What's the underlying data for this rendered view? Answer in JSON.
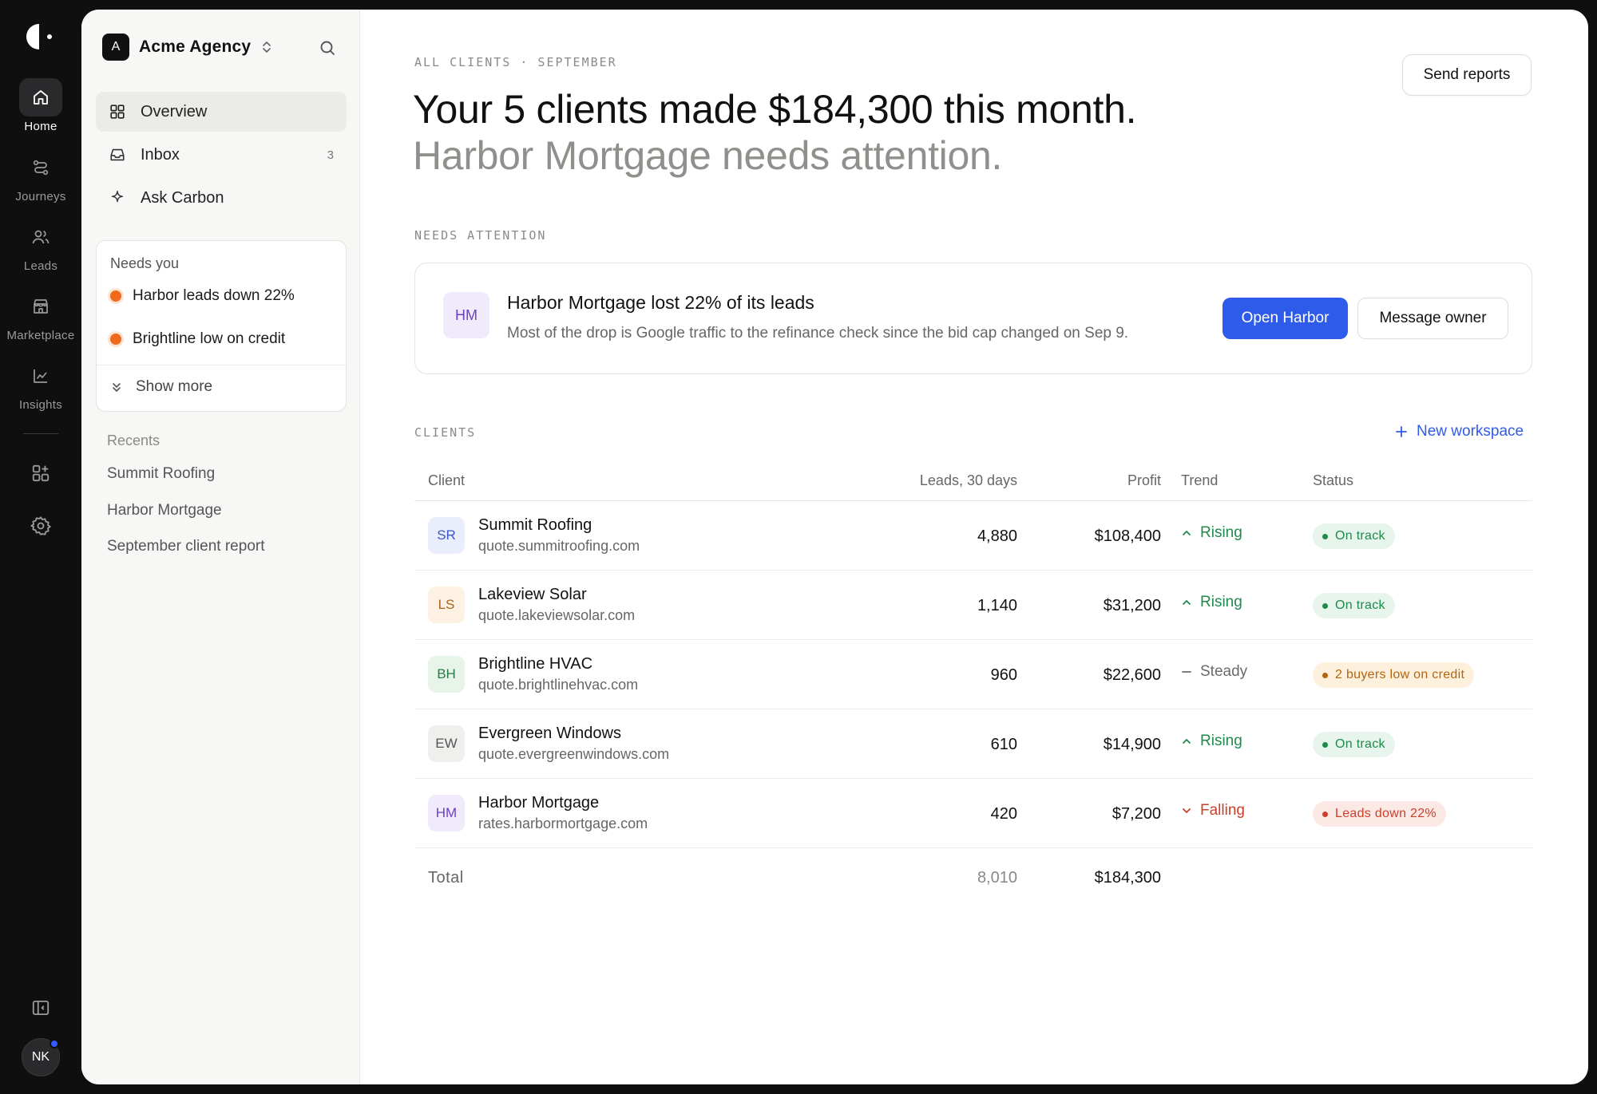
{
  "rail": {
    "items": [
      {
        "label": "Home",
        "icon": "home-icon"
      },
      {
        "label": "Journeys",
        "icon": "route-icon"
      },
      {
        "label": "Leads",
        "icon": "users-icon"
      },
      {
        "label": "Marketplace",
        "icon": "store-icon"
      },
      {
        "label": "Insights",
        "icon": "chart-icon"
      }
    ],
    "avatar": "NK"
  },
  "sidebar": {
    "workspace_initial": "A",
    "workspace_name": "Acme Agency",
    "nav": [
      {
        "label": "Overview"
      },
      {
        "label": "Inbox",
        "count": "3"
      },
      {
        "label": "Ask Carbon"
      }
    ],
    "needs": {
      "title": "Needs you",
      "items": [
        "Harbor leads down 22%",
        "Brightline low on credit"
      ],
      "more": "Show more"
    },
    "recents_title": "Recents",
    "recents": [
      "Summit Roofing",
      "Harbor Mortgage",
      "September client report"
    ]
  },
  "main": {
    "eyebrow": "ALL CLIENTS · SEPTEMBER",
    "send_reports": "Send reports",
    "headline": "Your 5 clients made $184,300 this month.",
    "subline": "Harbor Mortgage needs attention.",
    "attention_label": "NEEDS ATTENTION",
    "alert": {
      "initials": "HM",
      "title": "Harbor Mortgage lost 22% of its leads",
      "desc": "Most of the drop is Google traffic to the refinance check since the bid cap changed on Sep 9.",
      "primary": "Open Harbor",
      "secondary": "Message owner"
    },
    "clients_label": "CLIENTS",
    "new_workspace": "New workspace",
    "table": {
      "headers": {
        "client": "Client",
        "leads": "Leads, 30 days",
        "profit": "Profit",
        "trend": "Trend",
        "status": "Status"
      },
      "rows": [
        {
          "initials": "SR",
          "name": "Summit Roofing",
          "domain": "quote.summitroofing.com",
          "leads": "4,880",
          "profit": "$108,400",
          "trend": "Rising",
          "status": "On track"
        },
        {
          "initials": "LS",
          "name": "Lakeview Solar",
          "domain": "quote.lakeviewsolar.com",
          "leads": "1,140",
          "profit": "$31,200",
          "trend": "Rising",
          "status": "On track"
        },
        {
          "initials": "BH",
          "name": "Brightline HVAC",
          "domain": "quote.brightlinehvac.com",
          "leads": "960",
          "profit": "$22,600",
          "trend": "Steady",
          "status": "2 buyers low on credit"
        },
        {
          "initials": "EW",
          "name": "Evergreen Windows",
          "domain": "quote.evergreenwindows.com",
          "leads": "610",
          "profit": "$14,900",
          "trend": "Rising",
          "status": "On track"
        },
        {
          "initials": "HM",
          "name": "Harbor Mortgage",
          "domain": "rates.harbormortgage.com",
          "leads": "420",
          "profit": "$7,200",
          "trend": "Falling",
          "status": "Leads down 22%"
        }
      ],
      "total": {
        "label": "Total",
        "leads": "8,010",
        "profit": "$184,300"
      }
    }
  },
  "colors": {
    "accent": "#2f5bea",
    "rising": "#1f8a4c",
    "steady": "#6b6b68",
    "falling": "#c9412b",
    "warning": "#b5650d"
  }
}
